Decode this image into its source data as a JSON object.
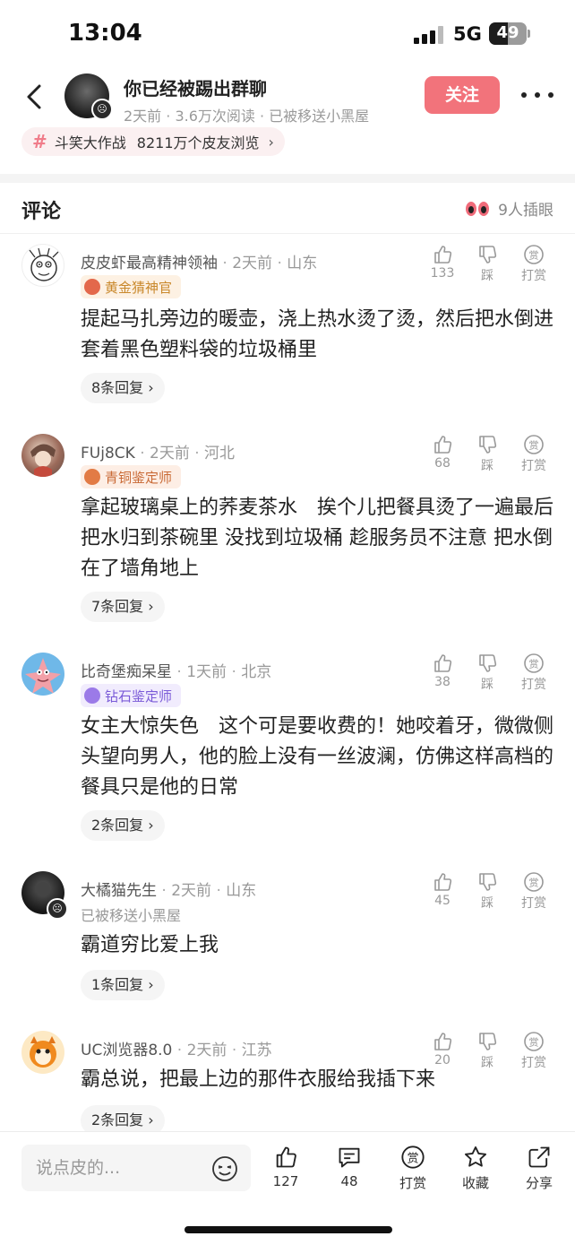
{
  "status_bar": {
    "time": "13:04",
    "network": "5G",
    "battery": "49",
    "battery_level": 0.49
  },
  "header": {
    "title": "你已经被踢出群聊",
    "subtitle": "2天前 · 3.6万次阅读 · 已被移送小黑屋",
    "follow_label": "关注",
    "topic": {
      "name": "斗笑大作战",
      "views": "8211万个皮友浏览",
      "chevron": "›"
    }
  },
  "comments_section": {
    "title": "评论",
    "watchers": "9人插眼"
  },
  "comments": [
    {
      "username": "皮皮虾最高精神领袖",
      "time": "2天前",
      "location": "山东",
      "badge": {
        "label": "黄金猜神官",
        "color": "#c9882b",
        "bg": "#fdf1e3"
      },
      "status": "",
      "text": "提起马扎旁边的暖壶，浇上热水烫了烫，然后把水倒进套着黑色塑料袋的垃圾桶里",
      "replies": "8条回复 ›",
      "likes": "133",
      "dislike_label": "踩",
      "reward_label": "打赏",
      "avatar_icon": "doodle-face-icon"
    },
    {
      "username": "FUj8CK",
      "time": "2天前",
      "location": "河北",
      "badge": {
        "label": "青铜鉴定师",
        "color": "#c96a36",
        "bg": "#fdeee5"
      },
      "status": "",
      "text": "拿起玻璃桌上的荞麦茶水　挨个儿把餐具烫了一遍最后把水归到茶碗里 没找到垃圾桶 趁服务员不注意 把水倒在了墙角地上",
      "replies": "7条回复 ›",
      "likes": "68",
      "dislike_label": "踩",
      "reward_label": "打赏",
      "avatar_icon": "anime-character-icon"
    },
    {
      "username": "比奇堡痴呆星",
      "time": "1天前",
      "location": "北京",
      "badge": {
        "label": "钻石鉴定师",
        "color": "#7a5ad8",
        "bg": "#f1ecfd"
      },
      "status": "",
      "text": "女主大惊失色　这个可是要收费的！她咬着牙，微微侧头望向男人，他的脸上没有一丝波澜，仿佛这样高档的餐具只是他的日常",
      "replies": "2条回复 ›",
      "likes": "38",
      "dislike_label": "踩",
      "reward_label": "打赏",
      "avatar_icon": "patrick-star-icon"
    },
    {
      "username": "大橘猫先生",
      "time": "2天前",
      "location": "山东",
      "badge": null,
      "status": "已被移送小黑屋",
      "text": "霸道穷比爱上我",
      "replies": "1条回复 ›",
      "likes": "45",
      "dislike_label": "踩",
      "reward_label": "打赏",
      "avatar_icon": "dark-avatar-icon"
    },
    {
      "username": "UC浏览器8.0",
      "time": "2天前",
      "location": "江苏",
      "badge": null,
      "status": "",
      "text": "霸总说，把最上边的那件衣服给我插下来",
      "replies": "2条回复 ›",
      "likes": "20",
      "dislike_label": "踩",
      "reward_label": "打赏",
      "avatar_icon": "uc-squirrel-icon"
    }
  ],
  "bottom_bar": {
    "input_placeholder": "说点皮的...",
    "likes": "127",
    "comments": "48",
    "reward": "打赏",
    "favorite": "收藏",
    "share": "分享"
  }
}
